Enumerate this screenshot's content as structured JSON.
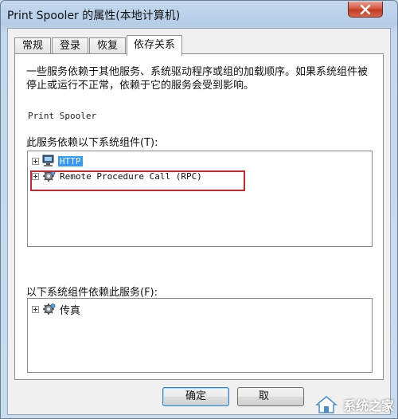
{
  "window": {
    "title": "Print Spooler 的属性(本地计算机)"
  },
  "tabs": [
    {
      "label": "常规"
    },
    {
      "label": "登录"
    },
    {
      "label": "恢复"
    },
    {
      "label": "依存关系"
    }
  ],
  "dependencies": {
    "description": "一些服务依赖于其他服务、系统驱动程序或组的加载顺序。如果系统组件被停止或运行不正常，依赖于它的服务会受到影响。",
    "service_name": "Print Spooler",
    "depends_on_label": "此服务依赖以下系统组件(T):",
    "depends_on": [
      {
        "label": "HTTP",
        "icon": "computer-icon",
        "selected": true
      },
      {
        "label": "Remote Procedure Call (RPC)",
        "icon": "gear-service-icon",
        "highlighted": true
      }
    ],
    "dependents_label": "以下系统组件依赖此服务(F):",
    "dependents": [
      {
        "label": "传真",
        "icon": "gear-service-icon"
      }
    ]
  },
  "buttons": {
    "ok": "确定",
    "cancel_partial": "取"
  },
  "watermark": {
    "text": "系统之家"
  },
  "colors": {
    "selection": "#3399ff",
    "annotation_box": "#c8282c",
    "close_button": "#c23b21"
  }
}
